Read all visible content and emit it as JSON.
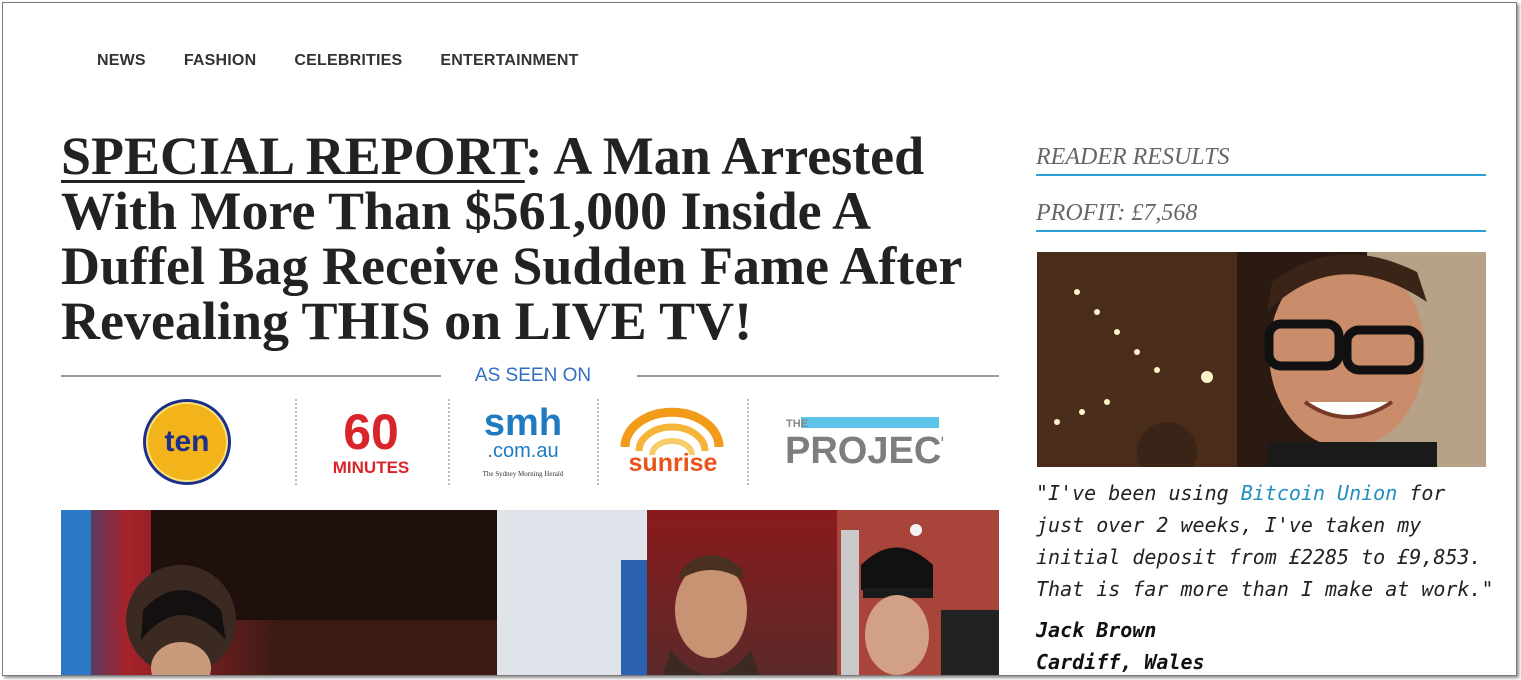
{
  "nav": {
    "items": [
      "NEWS",
      "FASHION",
      "CELEBRITIES",
      "ENTERTAINMENT"
    ]
  },
  "headline": {
    "lead": "SPECIAL REPORT",
    "rest": ": A Man Arrested With More Than $561,000 Inside A Duffel Bag Receive Sudden Fame After Revealing THIS on LIVE TV!"
  },
  "as_seen_on": {
    "label": "AS SEEN ON",
    "logos": {
      "ten": "ten",
      "sixty_number": "60",
      "sixty_word": "MINUTES",
      "smh_big": "smh",
      "smh_domain": ".com.au",
      "smh_small": "The Sydney Morning Herald",
      "sunrise": "sunrise",
      "project_the": "THE",
      "project_word": "PROJECT"
    }
  },
  "sidebar": {
    "reader_results": "READER RESULTS",
    "profit": "PROFIT: £7,568",
    "quote_before": "\"I've been using ",
    "quote_link": "Bitcoin Union",
    "quote_after": " for just over 2 weeks, I've taken my initial deposit from £2285 to £9,853. That is far more than I make at work.\"",
    "author_name": "Jack Brown",
    "author_location": "Cardiff, Wales"
  },
  "colors": {
    "accent_blue": "#2a9fd0",
    "link_blue": "#1e8fc0",
    "seen_blue": "#2f6fc0"
  },
  "icons": [
    "ten-logo",
    "60-minutes-logo",
    "smh-logo",
    "sunrise-logo",
    "the-project-logo"
  ]
}
